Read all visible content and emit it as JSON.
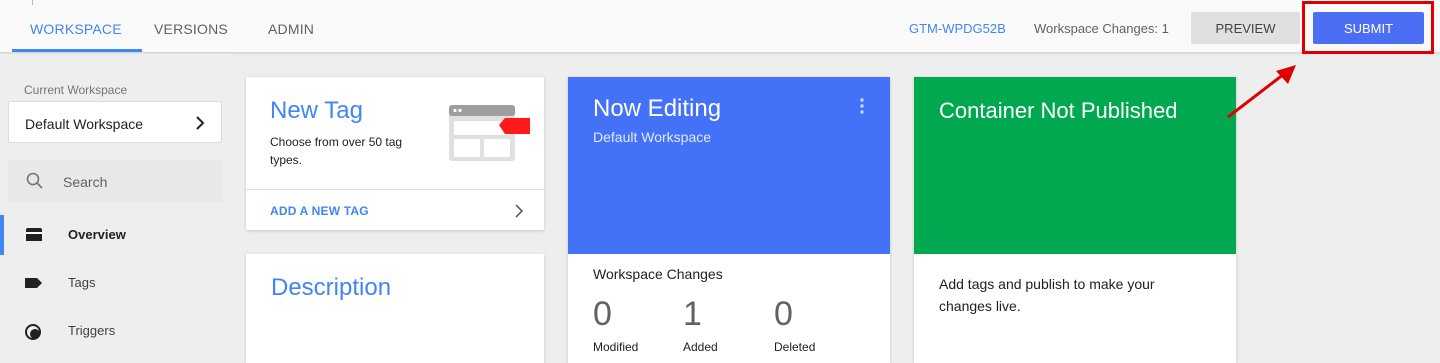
{
  "tabs": [
    {
      "label": "WORKSPACE",
      "active": true
    },
    {
      "label": "VERSIONS",
      "active": false
    },
    {
      "label": "ADMIN",
      "active": false
    }
  ],
  "header": {
    "container_id": "GTM-WPDG52B",
    "workspace_changes": "Workspace Changes: 1",
    "preview_label": "PREVIEW",
    "submit_label": "SUBMIT"
  },
  "sidebar": {
    "current_workspace_label": "Current Workspace",
    "workspace_name": "Default Workspace",
    "search_placeholder": "Search",
    "items": [
      {
        "label": "Overview",
        "icon": "folder-icon",
        "active": true
      },
      {
        "label": "Tags",
        "icon": "tag-icon",
        "active": false
      },
      {
        "label": "Triggers",
        "icon": "trigger-icon",
        "active": false
      }
    ]
  },
  "new_tag_card": {
    "title": "New Tag",
    "subtitle": "Choose from over 50 tag types.",
    "action": "ADD A NEW TAG"
  },
  "description_card": {
    "title": "Description"
  },
  "now_editing_card": {
    "title": "Now Editing",
    "workspace": "Default Workspace",
    "changes_heading": "Workspace Changes",
    "stats": [
      {
        "value": "0",
        "label": "Modified"
      },
      {
        "value": "1",
        "label": "Added"
      },
      {
        "value": "0",
        "label": "Deleted"
      }
    ]
  },
  "not_published_card": {
    "title": "Container Not Published",
    "message": "Add tags and publish to make your changes live."
  },
  "colors": {
    "accent": "#4285f4",
    "editing_band": "#4372f8",
    "published_band": "#00a94f",
    "highlight": "#e00000",
    "submit_button": "#4c6ef5"
  }
}
